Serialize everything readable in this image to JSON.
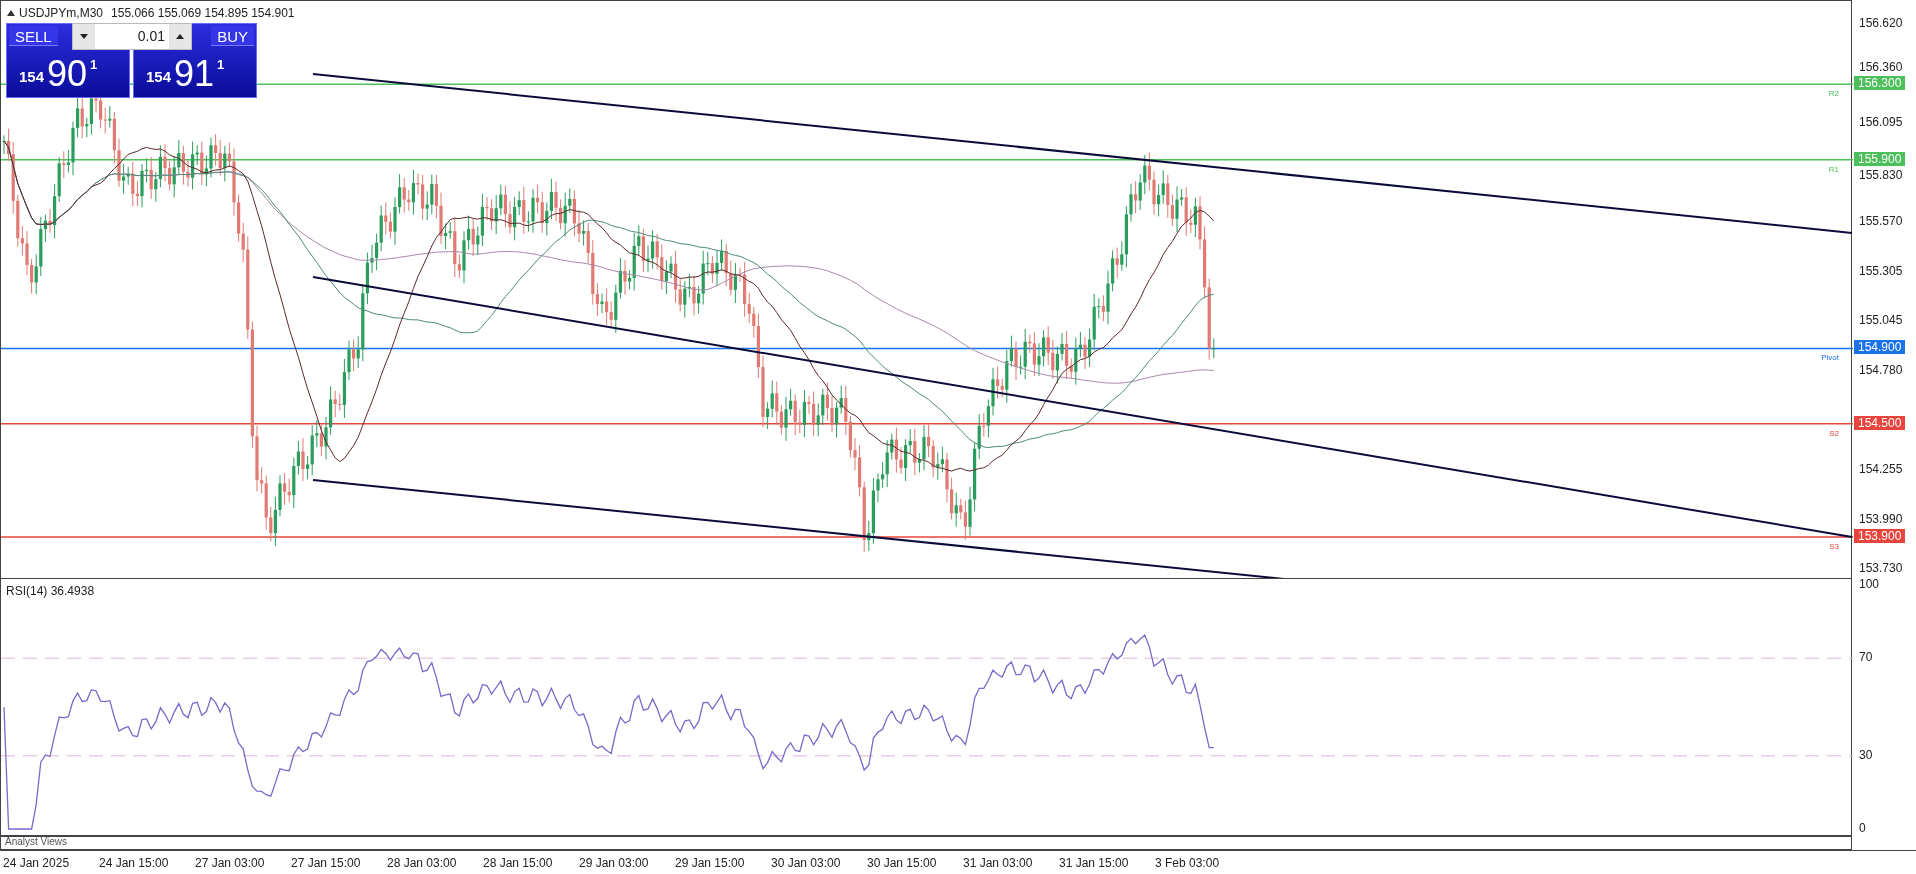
{
  "chart_header": {
    "symbol": "USDJPYm,M30",
    "ohlc": "155.066 155.069 154.895 154.901"
  },
  "trade_panel": {
    "sell": {
      "label": "SELL",
      "price_big": "154",
      "price_main": "90",
      "price_sup": "1"
    },
    "lot": "0.01",
    "buy": {
      "label": "BUY",
      "price_big": "154",
      "price_main": "91",
      "price_sup": "1"
    }
  },
  "price_axis": {
    "ticks": [
      "156.620",
      "156.360",
      "156.095",
      "155.830",
      "155.570",
      "155.305",
      "155.045",
      "154.780",
      "154.255",
      "153.990",
      "153.730"
    ]
  },
  "levels": [
    {
      "name": "R2",
      "price": "156.300",
      "color": "#4cc05a"
    },
    {
      "name": "R1",
      "price": "155.900",
      "color": "#4cc05a"
    },
    {
      "name": "Pivot",
      "price": "154.900",
      "color": "#1a73e8"
    },
    {
      "name": "S2",
      "price": "154.500",
      "color": "#e8453c"
    },
    {
      "name": "S3",
      "price": "153.900",
      "color": "#e8453c"
    }
  ],
  "rsi_panel": {
    "label": "RSI(14) 36.4938",
    "ticks": [
      "100",
      "70",
      "30",
      "0"
    ]
  },
  "analyst_strip": {
    "label": "Analyst Views"
  },
  "time_axis": {
    "labels": [
      "24 Jan 2025",
      "24 Jan 15:00",
      "27 Jan 03:00",
      "27 Jan 15:00",
      "28 Jan 03:00",
      "28 Jan 15:00",
      "29 Jan 03:00",
      "29 Jan 15:00",
      "30 Jan 03:00",
      "30 Jan 15:00",
      "31 Jan 03:00",
      "31 Jan 15:00",
      "3 Feb 03:00"
    ]
  }
}
